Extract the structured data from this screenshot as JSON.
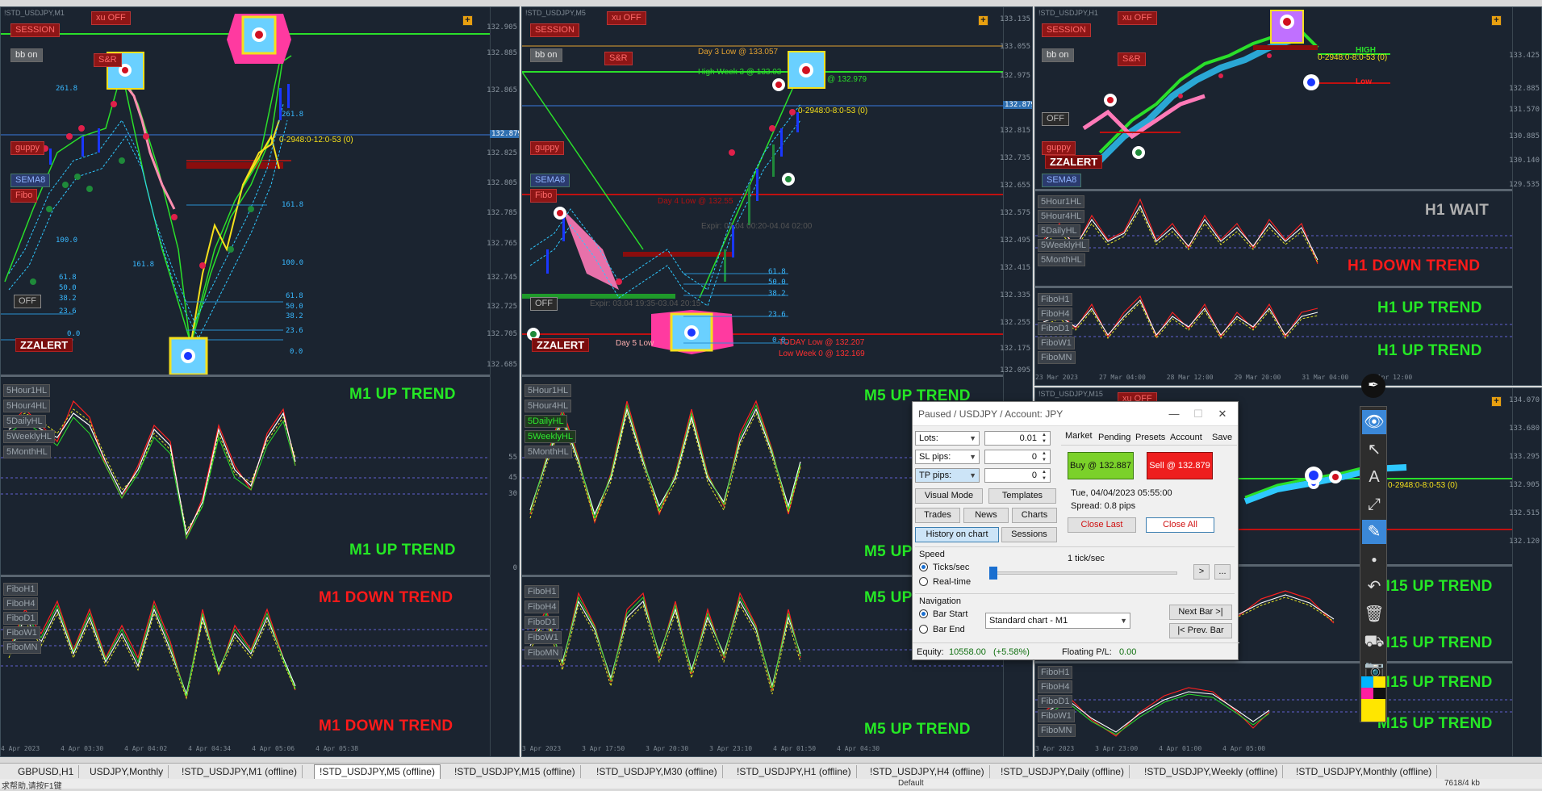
{
  "charts": {
    "m1": {
      "symbol": "!STD_USDJPY,M1",
      "xu_label": "xu OFF",
      "session_label": "SESSION",
      "bb_label": "bb on",
      "sr_label": "S&R",
      "guppy_label": "guppy",
      "sema_label": "SEMA8",
      "fibo_label": "Fibo",
      "off_label": "OFF",
      "zz_label": "ZZALERT",
      "prices": [
        "132.905",
        "132.885",
        "132.865",
        "132.845",
        "132.825",
        "132.805",
        "132.785",
        "132.765",
        "132.745",
        "132.725",
        "132.705",
        "132.685",
        "132.665"
      ],
      "price_tag": "132.879",
      "fib_levels": [
        "261.8",
        "161.8",
        "100.0",
        "61.8",
        "50.0",
        "38.2",
        "23.6",
        "0.0"
      ],
      "fib_levels_b": [
        "261.8",
        "161.8",
        "100.0",
        "61.8",
        "50.0",
        "38.2",
        "23.6",
        "0.0"
      ],
      "annotation": "0-2948:0-12:0-53 (0)",
      "hl_list": [
        "5Hour1HL",
        "5Hour4HL",
        "5DailyHL",
        "5WeeklyHL",
        "5MonthHL"
      ],
      "fibo_list": [
        "FiboH1",
        "FiboH4",
        "FiboD1",
        "FiboW1",
        "FiboMN"
      ],
      "trend_mid_top": "M1 UP TREND",
      "trend_mid_bottom": "M1 UP TREND",
      "trend_low_top": "M1 DOWN TREND",
      "trend_low_bottom": "M1 DOWN TREND",
      "osc_ticks": [
        "55",
        "45",
        "30",
        "0"
      ],
      "times": [
        "4 Apr 2023",
        "4 Apr 03:30",
        "4 Apr 04:02",
        "4 Apr 04:34",
        "4 Apr 05:06",
        "4 Apr 05:38"
      ]
    },
    "m5": {
      "symbol": "!STD_USDJPY,M5",
      "xu_label": "xu OFF",
      "session_label": "SESSION",
      "bb_label": "bb on",
      "sr_label": "S&R",
      "guppy_label": "guppy",
      "sema_label": "SEMA8",
      "fibo_label": "Fibo",
      "off_label": "OFF",
      "zz_label": "ZZALERT",
      "prices": [
        "133.135",
        "133.055",
        "132.975",
        "132.895",
        "132.815",
        "132.735",
        "132.655",
        "132.575",
        "132.495",
        "132.415",
        "132.335",
        "132.255",
        "132.175",
        "132.095"
      ],
      "price_tag": "132.879",
      "day3_low": "Day 3 Low @ 133.057",
      "high_week": "High Week 3 @ 133.03",
      "level_979": "@ 132.979",
      "annotation": "0-2948:0-8:0-53 (0)",
      "day4_low": "Day 4 Low @ 132.55",
      "expir1": "Expir: 04.04 00:20-04.04 02:00",
      "expir2": "Expir: 03.04 19:35-03.04 20:15",
      "day5_low": "Day 5 Low",
      "today_low": "TODAY Low @ 132.207",
      "lowest": "Low Week 0 @ 132.169",
      "fib_levels": [
        "61.8",
        "50.0",
        "38.2",
        "23.6",
        "0.0"
      ],
      "hl_list": [
        "5Hour1HL",
        "5Hour4HL",
        "5DailyHL",
        "5WeeklyHL",
        "5MonthHL"
      ],
      "fibo_list": [
        "FiboH1",
        "FiboH4",
        "FiboD1",
        "FiboW1",
        "FiboMN"
      ],
      "trend_mid_top": "M5 UP TREND",
      "trend_mid_bottom": "M5 UP TREND",
      "trend_low_top": "M5 UP TREND",
      "trend_low_bottom": "M5 UP TREND",
      "times": [
        "3 Apr 2023",
        "3 Apr 17:50",
        "3 Apr 20:30",
        "3 Apr 23:10",
        "4 Apr 01:50",
        "4 Apr 04:30"
      ]
    },
    "h1": {
      "symbol": "!STD_USDJPY,H1",
      "xu_label": "xu OFF",
      "session_label": "SESSION",
      "bb_label": "bb on",
      "sr_label": "S&R",
      "guppy_label": "guppy",
      "sema_label": "SEMA8",
      "off_label": "OFF",
      "zz_label": "ZZALERT",
      "high_label": "HIGH",
      "low_label": "Low",
      "annotation": "0-2948:0-8:0-53 (0)",
      "prices": [
        "133.425",
        "132.885",
        "131.570",
        "130.885",
        "130.140",
        "129.535"
      ],
      "hl_list": [
        "5Hour1HL",
        "5Hour4HL",
        "5DailyHL",
        "5WeeklyHL",
        "5MonthHL"
      ],
      "fibo_list": [
        "FiboH1",
        "FiboH4",
        "FiboD1",
        "FiboW1",
        "FiboMN"
      ],
      "trend_wait": "H1 WAIT",
      "trend_mid": "H1 DOWN TREND",
      "trend_low_top": "H1 UP TREND",
      "trend_low_bottom": "H1 UP TREND",
      "times": [
        "23 Mar 2023",
        "27 Mar 04:00",
        "28 Mar 12:00",
        "29 Mar 20:00",
        "31 Mar 04:00",
        "3 Apr 12:00"
      ]
    },
    "m15": {
      "symbol": "!STD_USDJPY,M15",
      "xu_label": "xu OFF",
      "annotation": "0-2948:0-8:0-53 (0)",
      "prices": [
        "134.070",
        "133.680",
        "133.295",
        "132.905",
        "132.515",
        "132.120"
      ],
      "fibo_list": [
        "FiboH1",
        "FiboH4",
        "FiboD1",
        "FiboW1",
        "FiboMN"
      ],
      "trend_1": "M15 UP TREND",
      "trend_2": "M15 UP TREND",
      "trend_3": "M15 UP TREND",
      "trend_4": "M15 UP TREND",
      "times": [
        "3 Apr 2023",
        "3 Apr 23:00",
        "4 Apr 01:00",
        "4 Apr 05:00"
      ]
    }
  },
  "dialog": {
    "title": "Paused / USDJPY / Account: JPY",
    "lots_label": "Lots:",
    "lots_value": "0.01",
    "sl_label": "SL pips:",
    "sl_value": "0",
    "tp_label": "TP pips:",
    "tp_value": "0",
    "tabs": [
      "Market",
      "Pending",
      "Presets",
      "Account",
      "Save"
    ],
    "buy_label": "Buy @ 132.887",
    "sell_label": "Sell @ 132.879",
    "datetime": "Tue, 04/04/2023  05:55:00",
    "spread": "Spread: 0.8 pips",
    "close_last": "Close Last",
    "close_all": "Close All",
    "visual_mode": "Visual Mode",
    "templates": "Templates",
    "trades": "Trades",
    "news": "News",
    "charts": "Charts",
    "history_on_chart": "History on chart",
    "sessions": "Sessions",
    "speed_label": "Speed",
    "speed_value": "1 tick/sec",
    "ticks_sec": "Ticks/sec",
    "real_time": "Real-time",
    "play": ">",
    "more": "...",
    "navigation_label": "Navigation",
    "bar_start": "Bar Start",
    "bar_end": "Bar End",
    "chart_select": "Standard chart - M1",
    "next_bar": "Next Bar >|",
    "prev_bar": "|< Prev. Bar",
    "equity_label": "Equity:",
    "equity_value": "10558.00",
    "equity_pct": "(+5.58%)",
    "floating_label": "Floating P/L:",
    "floating_value": "0.00",
    "speed_fraction": 0.0
  },
  "tabs": [
    "GBPUSD,H1",
    "USDJPY,Monthly",
    "!STD_USDJPY,M1 (offline)",
    "!STD_USDJPY,M5 (offline)",
    "!STD_USDJPY,M15 (offline)",
    "!STD_USDJPY,M30 (offline)",
    "!STD_USDJPY,H1 (offline)",
    "!STD_USDJPY,H4 (offline)",
    "!STD_USDJPY,Daily (offline)",
    "!STD_USDJPY,Weekly (offline)",
    "!STD_USDJPY,Monthly (offline)"
  ],
  "status": {
    "left": "求帮助,请按F1键",
    "profile": "Default",
    "traffic": "7618/4 kb"
  },
  "colors": {
    "up": "#25e825",
    "down": "#ff1a1a",
    "chart_bg": "#1b2430",
    "accent_blue": "#3b88d8"
  }
}
